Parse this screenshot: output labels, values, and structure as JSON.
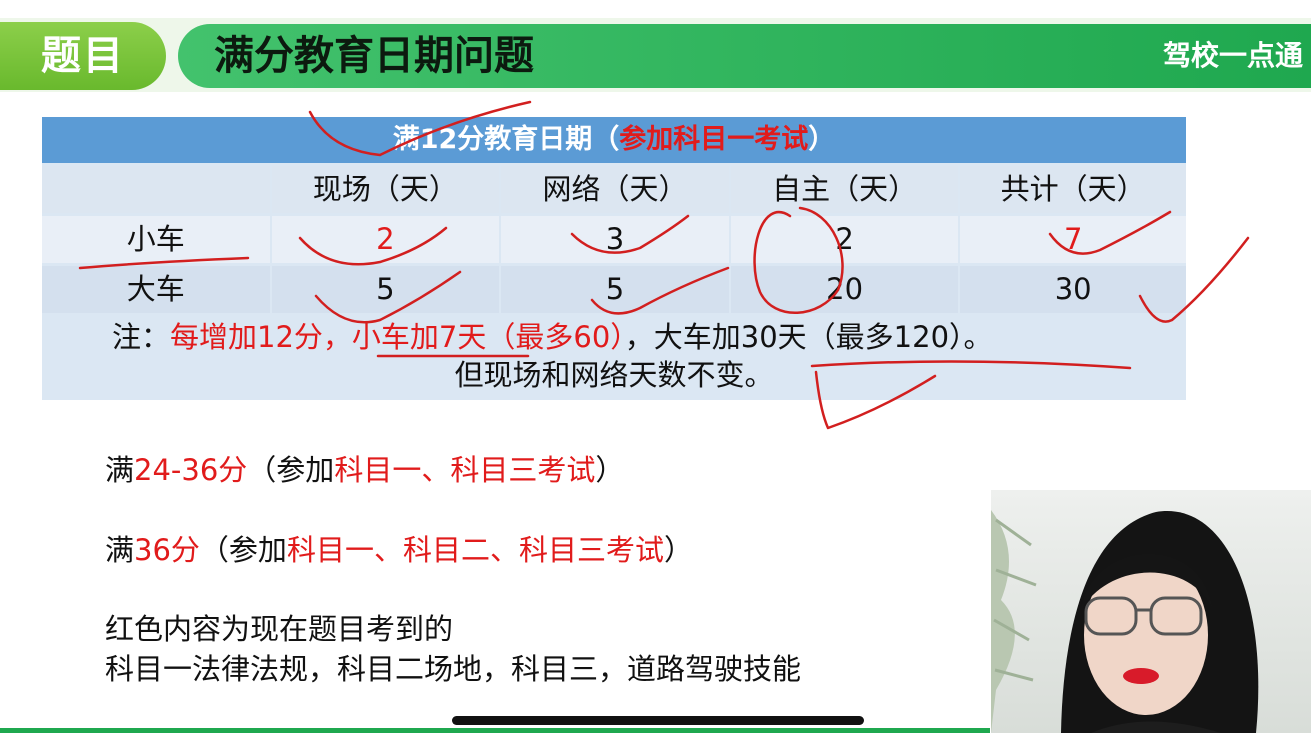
{
  "header": {
    "tab_label": "题目",
    "title": "满分教育日期问题",
    "brand": "驾校一点通"
  },
  "table": {
    "title_prefix": "满12分教育日期（",
    "title_red": "参加科目一考试",
    "title_suffix": "）",
    "columns": [
      "",
      "现场（天）",
      "网络（天）",
      "自主（天）",
      "共计（天）"
    ],
    "rows": [
      {
        "label": "小车",
        "values": [
          "2",
          "3",
          "2",
          "7"
        ]
      },
      {
        "label": "大车",
        "values": [
          "5",
          "5",
          "20",
          "30"
        ]
      }
    ],
    "note": {
      "prefix": "注：",
      "red1": "每增加12分，",
      "red2": "小车加7天（最多60）",
      "rest": "，大车加30天（最多120）。",
      "line2": "但现场和网络天数不变。"
    }
  },
  "lines": {
    "l1": {
      "a": "满",
      "b": "24-36分",
      "c": "（参加",
      "d": "科目一、科目三考试",
      "e": "）"
    },
    "l2": {
      "a": "满",
      "b": "36分",
      "c": "（参加",
      "d": "科目一、科目二、科目三考试",
      "e": "）"
    },
    "l3": "红色内容为现在题目考到的",
    "l4": "科目一法律法规，科目二场地，科目三，道路驾驶技能"
  },
  "colors": {
    "green": "#1fa84f",
    "tab_green": "#7cc43e",
    "table_header_blue": "#5b9bd5",
    "red": "#e11b1b",
    "annotation_red": "#d21f1f"
  }
}
